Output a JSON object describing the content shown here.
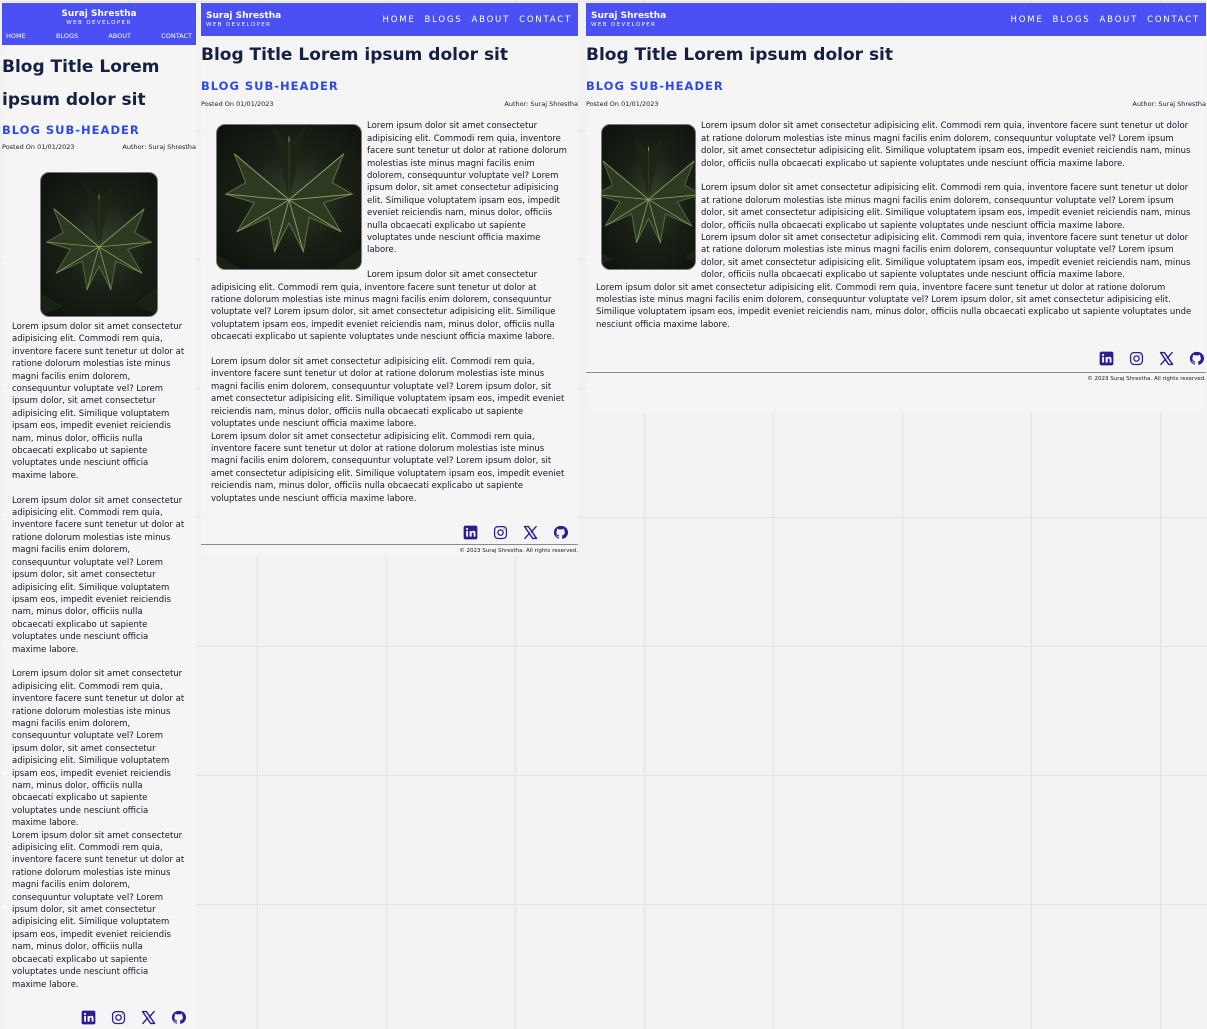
{
  "brand": {
    "name": "Suraj Shrestha",
    "tagline": "WEB DEVELOPER"
  },
  "nav": [
    "HOME",
    "BLOGS",
    "ABOUT",
    "CONTACT"
  ],
  "nav_mobile": [
    "HOME",
    "BLOGS",
    "ABOUT",
    "CONTACT"
  ],
  "post": {
    "title": "Blog Title Lorem ipsum dolor sit",
    "subheader": "BLOG SUB-HEADER",
    "posted_on": "Posted On 01/01/2023",
    "author": "Author: Suraj Shrestha",
    "paragraph": "Lorem ipsum dolor sit amet consectetur adipisicing elit. Commodi rem quia, inventore facere sunt tenetur ut dolor at ratione dolorum molestias iste minus magni facilis enim dolorem, consequuntur voluptate vel? Lorem ipsum dolor, sit amet consectetur adipisicing elit. Similique voluptatem ipsam eos, impedit eveniet reiciendis nam, minus dolor, officiis nulla obcaecati explicabo ut sapiente voluptates unde nesciunt officia maxime labore."
  },
  "socials": [
    "linkedin-icon",
    "instagram-icon",
    "x-icon",
    "github-icon"
  ],
  "footer": {
    "copyright": "© 2023 Suraj Shrestha. All rights reserved."
  },
  "colors": {
    "header": "#4a50f3",
    "title": "#152042",
    "subheader": "#2d49e8",
    "icon": "#2b1d8f",
    "background": "#f2f2f2"
  }
}
